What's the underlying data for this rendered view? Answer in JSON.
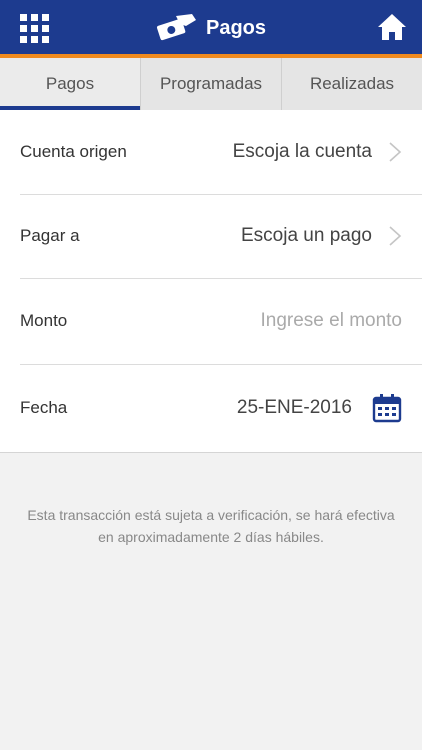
{
  "header": {
    "title": "Pagos",
    "menu_icon": "grid-menu-icon",
    "title_icon": "money-hand-icon",
    "home_icon": "home-icon",
    "colors": {
      "bar": "#1d3b8f",
      "accent": "#f08a1e"
    }
  },
  "tabs": [
    {
      "label": "Pagos",
      "active": true
    },
    {
      "label": "Programadas",
      "active": false
    },
    {
      "label": "Realizadas",
      "active": false
    }
  ],
  "form": {
    "cuenta_origen": {
      "label": "Cuenta origen",
      "value": "Escoja la cuenta"
    },
    "pagar_a": {
      "label": "Pagar a",
      "value": "Escoja un pago"
    },
    "monto": {
      "label": "Monto",
      "placeholder": "Ingrese el monto"
    },
    "fecha": {
      "label": "Fecha",
      "value": "25-ENE-2016",
      "icon": "calendar-icon"
    }
  },
  "note": "Esta transacción está sujeta a verificación, se hará efectiva en aproximadamente 2 días hábiles."
}
